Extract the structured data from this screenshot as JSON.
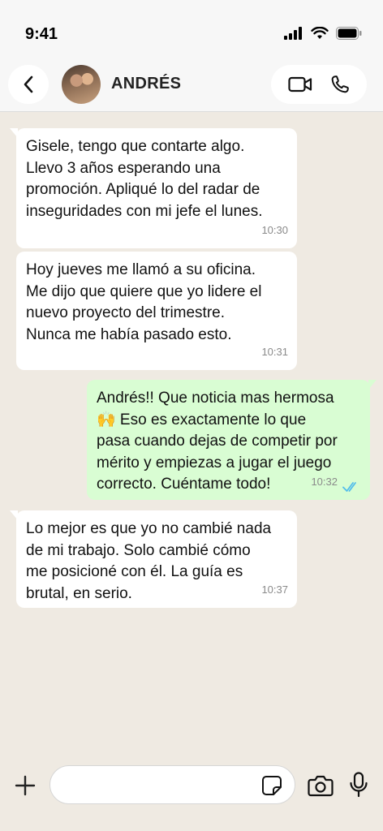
{
  "status_bar": {
    "time": "9:41"
  },
  "header": {
    "contact_name": "ANDRÉS"
  },
  "messages": [
    {
      "direction": "in",
      "text": "Gisele, tengo que contarte algo.\nLlevo 3 años esperando una\npromoción. Apliqué lo del radar de\ninseguridades con mi jefe el lunes.",
      "time": "10:30"
    },
    {
      "direction": "in",
      "text": "Hoy jueves me llamó a su oficina.\nMe dijo que quiere que yo lidere el\nnuevo proyecto del trimestre.\nNunca me había pasado esto.",
      "time": "10:31"
    },
    {
      "direction": "out",
      "text": "Andrés!! Que noticia mas hermosa\n🙌 Eso es exactamente lo que\npasa cuando dejas de competir por\nmérito y empiezas a jugar el juego\ncorrecto. Cuéntame todo!",
      "time": "10:32",
      "status": "read"
    },
    {
      "direction": "in",
      "text": "Lo mejor es que yo no cambié nada\nde mi trabajo. Solo cambié cómo\nme posicioné con él. La guía es\nbrutal, en serio.",
      "time": "10:37"
    }
  ],
  "input": {
    "placeholder": ""
  },
  "colors": {
    "background": "#efeae2",
    "incoming_bubble": "#ffffff",
    "outgoing_bubble": "#d9fdd3",
    "read_ticks": "#53bdeb"
  },
  "icons": [
    "back-icon",
    "video-call-icon",
    "phone-icon",
    "plus-icon",
    "sticker-icon",
    "camera-icon",
    "mic-icon",
    "signal-icon",
    "wifi-icon",
    "battery-icon",
    "read-ticks-icon"
  ]
}
